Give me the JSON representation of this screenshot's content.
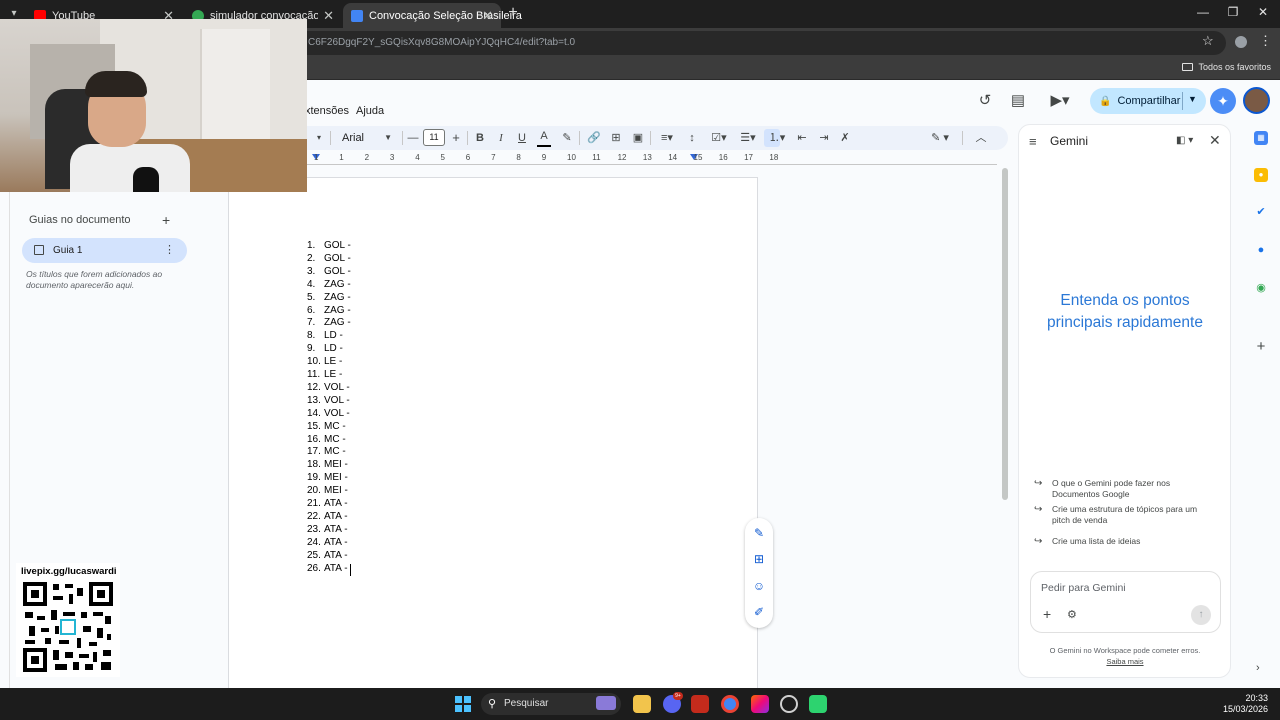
{
  "browser": {
    "tabs": [
      {
        "label": "YouTube",
        "color": "#ff0000",
        "active": false
      },
      {
        "label": "simulador convocação seleção",
        "color": "#34a853",
        "active": false
      },
      {
        "label": "Convocação Seleção Brasileira",
        "color": "#4285f4",
        "active": true
      }
    ],
    "url": "C6F26DgqF2Y_sGQisXqv8G8MOAipYJQqHC4/edit?tab=t.0",
    "bookmarks_all": "Todos os favoritos"
  },
  "docs": {
    "menu": {
      "extensions": "xtensões",
      "help": "Ajuda"
    },
    "share_label": "Compartilhar",
    "toolbar": {
      "font": "Arial",
      "font_size": "11"
    },
    "ruler": [
      "1",
      "1",
      "2",
      "3",
      "4",
      "5",
      "6",
      "7",
      "8",
      "9",
      "10",
      "11",
      "12",
      "13",
      "14",
      "15",
      "16",
      "17",
      "18"
    ],
    "outline": {
      "title": "Guias no documento",
      "tab_label": "Guia 1",
      "hint": "Os títulos que forem adicionados ao documento aparecerão aqui."
    },
    "list": [
      {
        "n": "1.",
        "t": "GOL -"
      },
      {
        "n": "2.",
        "t": "GOL -"
      },
      {
        "n": "3.",
        "t": "GOL -"
      },
      {
        "n": "4.",
        "t": "ZAG -"
      },
      {
        "n": "5.",
        "t": "ZAG -"
      },
      {
        "n": "6.",
        "t": "ZAG -"
      },
      {
        "n": "7.",
        "t": "ZAG -"
      },
      {
        "n": "8.",
        "t": "LD -"
      },
      {
        "n": "9.",
        "t": "LD -"
      },
      {
        "n": "10.",
        "t": "LE -"
      },
      {
        "n": "11.",
        "t": "LE -"
      },
      {
        "n": "12.",
        "t": "VOL -"
      },
      {
        "n": "13.",
        "t": "VOL -"
      },
      {
        "n": "14.",
        "t": "VOL -"
      },
      {
        "n": "15.",
        "t": "MC -"
      },
      {
        "n": "16.",
        "t": "MC -"
      },
      {
        "n": "17.",
        "t": "MC -"
      },
      {
        "n": "18.",
        "t": "MEI -"
      },
      {
        "n": "19.",
        "t": "MEI -"
      },
      {
        "n": "20.",
        "t": "MEI -"
      },
      {
        "n": "21.",
        "t": "ATA -"
      },
      {
        "n": "22.",
        "t": "ATA -"
      },
      {
        "n": "23.",
        "t": "ATA -"
      },
      {
        "n": "24.",
        "t": "ATA -"
      },
      {
        "n": "25.",
        "t": "ATA -"
      },
      {
        "n": "26.",
        "t": "ATA -"
      }
    ]
  },
  "gemini": {
    "title": "Gemini",
    "hero": "Entenda os pontos principais rapidamente",
    "suggestions": [
      "O que o Gemini pode fazer nos Documentos Google",
      "Crie uma estrutura de tópicos para um pitch de venda",
      "Crie uma lista de ideias"
    ],
    "input_placeholder": "Pedir para Gemini",
    "footer_text": "O Gemini no Workspace pode cometer erros.",
    "footer_link": "Saiba mais"
  },
  "overlay": {
    "livepix": "livepix.gg/lucaswardi"
  },
  "taskbar": {
    "search": "Pesquisar",
    "badge": "9+",
    "time": "20:33",
    "date": "15/03/2026"
  },
  "colors": {
    "accent": "#0b57d0",
    "share_bg": "#c2e7ff",
    "gemini_hero": "#2b78d6",
    "toolbar_bg": "#edf2fa"
  }
}
